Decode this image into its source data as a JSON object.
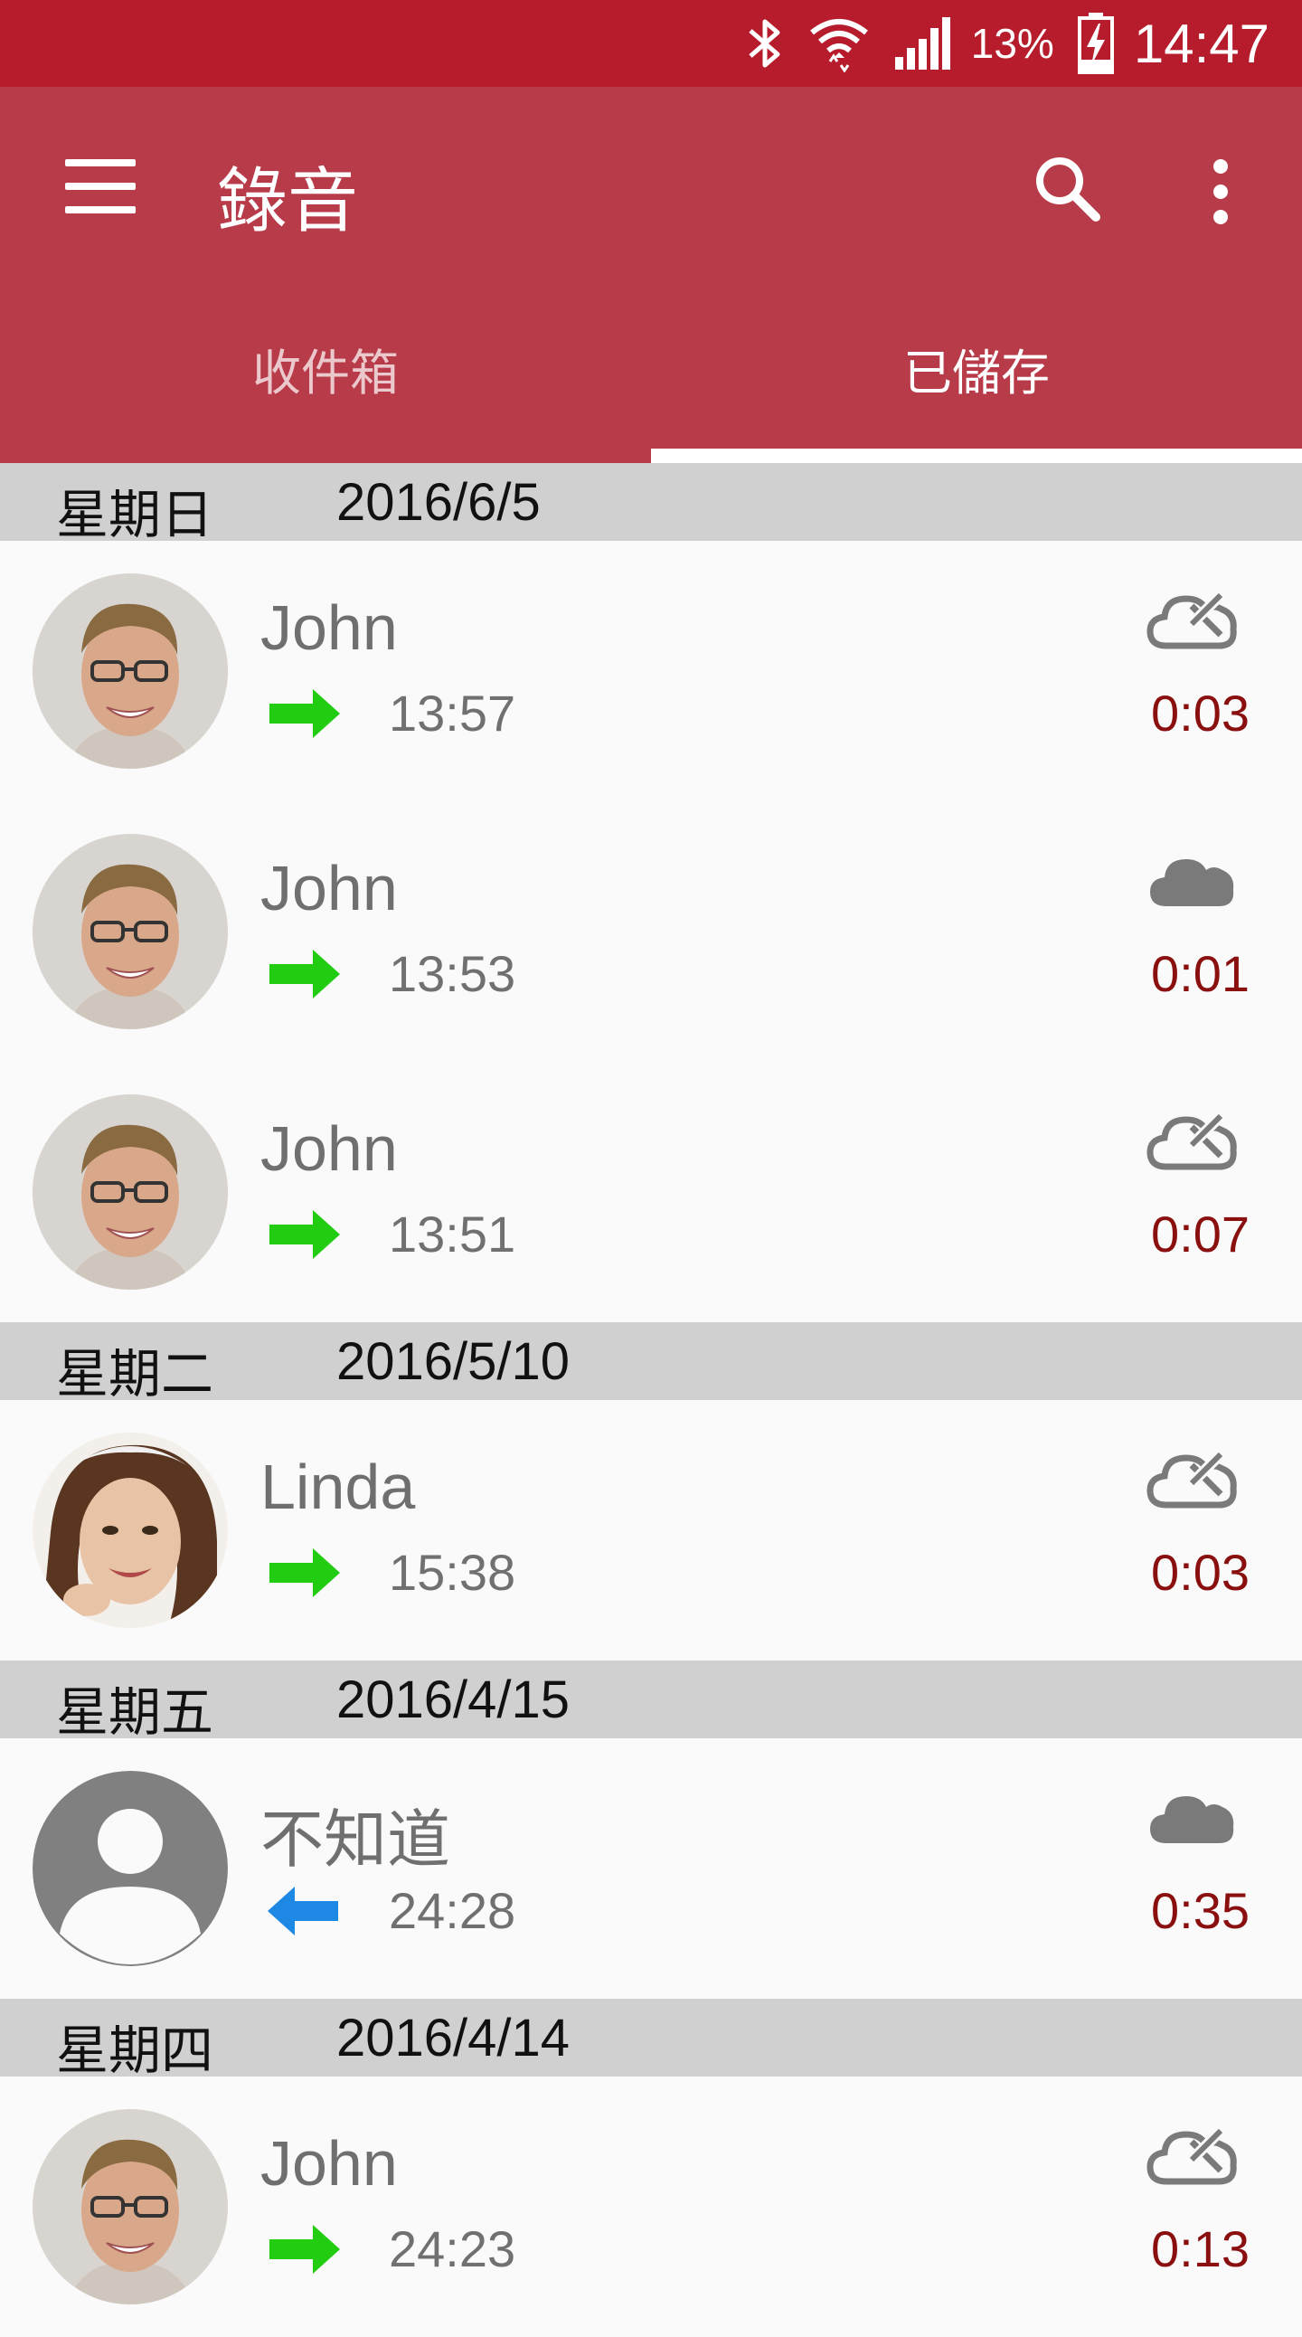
{
  "status_bar": {
    "battery_percent": "13%",
    "time": "14:47",
    "icons": [
      "bluetooth-icon",
      "wifi-icon",
      "signal-icon",
      "battery-charging-icon"
    ]
  },
  "toolbar": {
    "title": "錄音",
    "icons": [
      "menu-icon",
      "search-icon",
      "more-vert-icon"
    ]
  },
  "tabs": [
    {
      "label": "收件箱",
      "active": false
    },
    {
      "label": "已儲存",
      "active": true
    }
  ],
  "groups": [
    {
      "day": "星期日",
      "date": "2016/6/5",
      "items": [
        {
          "name": "John",
          "direction": "outgoing",
          "time": "13:57",
          "duration": "0:03",
          "cloud": "cloud-off-icon",
          "avatar": "male-photo"
        },
        {
          "name": "John",
          "direction": "outgoing",
          "time": "13:53",
          "duration": "0:01",
          "cloud": "cloud-filled-icon",
          "avatar": "male-photo"
        },
        {
          "name": "John",
          "direction": "outgoing",
          "time": "13:51",
          "duration": "0:07",
          "cloud": "cloud-off-icon",
          "avatar": "male-photo"
        }
      ]
    },
    {
      "day": "星期二",
      "date": "2016/5/10",
      "items": [
        {
          "name": "Linda",
          "direction": "outgoing",
          "time": "15:38",
          "duration": "0:03",
          "cloud": "cloud-off-icon",
          "avatar": "female-photo"
        }
      ]
    },
    {
      "day": "星期五",
      "date": "2016/4/15",
      "items": [
        {
          "name": "不知道",
          "direction": "incoming",
          "time": "24:28",
          "duration": "0:35",
          "cloud": "cloud-filled-icon",
          "avatar": "default-person"
        }
      ]
    },
    {
      "day": "星期四",
      "date": "2016/4/14",
      "items": [
        {
          "name": "John",
          "direction": "outgoing",
          "time": "24:23",
          "duration": "0:13",
          "cloud": "cloud-off-icon",
          "avatar": "male-photo"
        }
      ]
    }
  ],
  "colors": {
    "status_bar": "#b71c2c",
    "app_bar": "#b83b4a",
    "header_bg": "#d0d0d0",
    "outgoing_arrow": "#22cc11",
    "incoming_arrow": "#1e88e5",
    "duration_text": "#8a1010"
  }
}
